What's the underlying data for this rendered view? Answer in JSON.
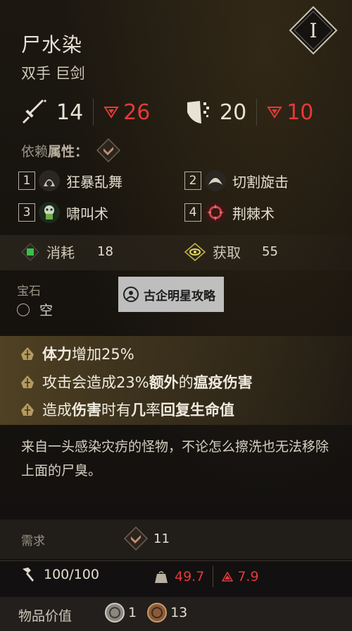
{
  "rank": "I",
  "item": {
    "name": "尸水染",
    "type": "双手 巨剑"
  },
  "stats": {
    "attack": "14",
    "attack_req": "26",
    "defense": "20",
    "defense_req": "10"
  },
  "attribute": {
    "label_normal": "依赖",
    "label_bold": "属性："
  },
  "skills": [
    {
      "num": "1",
      "name": "狂暴乱舞"
    },
    {
      "num": "2",
      "name": "切割旋击"
    },
    {
      "num": "3",
      "name": "啸叫术"
    },
    {
      "num": "4",
      "name": "荆棘术"
    }
  ],
  "cost": {
    "consume_label": "消耗",
    "consume_value": "18",
    "gain_label": "获取",
    "gain_value": "55"
  },
  "gem": {
    "title": "宝石",
    "slot": "空"
  },
  "watermark": "古企明星攻略",
  "effects": {
    "e1_bold": "体力",
    "e1_rest": "增加25%",
    "e2_a": "攻击会造成23%",
    "e2_b": "额外",
    "e2_c": "的",
    "e2_d": "瘟疫伤害",
    "e3_a": "造成",
    "e3_b": "伤害",
    "e3_c": "时有",
    "e3_d": "几",
    "e3_e": "率",
    "e3_f": "回复生命值"
  },
  "description": "来自一头感染灾疠的怪物，不论怎么擦洗也无法移除上面的尸臭。",
  "requirement": {
    "label": "需求",
    "value": "11"
  },
  "durability": {
    "value": "100/100",
    "weight": "49.7",
    "weight_req": "7.9"
  },
  "price": {
    "label": "物品价值",
    "silver": "1",
    "copper": "13"
  },
  "colors": {
    "red": "#e23a3a",
    "accent_gold": "#b59a5e",
    "bg": "#15120d"
  }
}
